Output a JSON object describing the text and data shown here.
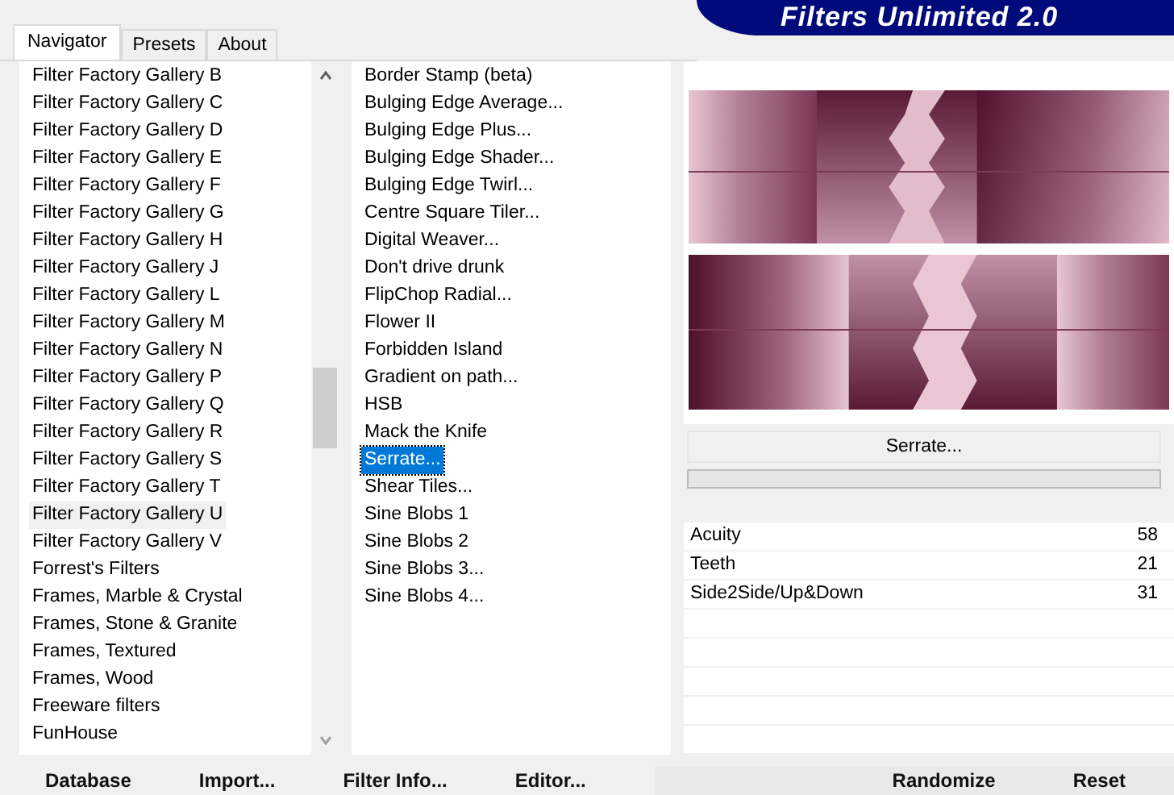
{
  "title": "Filters Unlimited 2.0",
  "tabs": [
    {
      "label": "Navigator",
      "selected": true
    },
    {
      "label": "Presets",
      "selected": false
    },
    {
      "label": "About",
      "selected": false
    }
  ],
  "categories": [
    {
      "label": "Filter Factory Gallery B",
      "selected": false
    },
    {
      "label": "Filter Factory Gallery C",
      "selected": false
    },
    {
      "label": "Filter Factory Gallery D",
      "selected": false
    },
    {
      "label": "Filter Factory Gallery E",
      "selected": false
    },
    {
      "label": "Filter Factory Gallery F",
      "selected": false
    },
    {
      "label": "Filter Factory Gallery G",
      "selected": false
    },
    {
      "label": "Filter Factory Gallery H",
      "selected": false
    },
    {
      "label": "Filter Factory Gallery J",
      "selected": false
    },
    {
      "label": "Filter Factory Gallery L",
      "selected": false
    },
    {
      "label": "Filter Factory Gallery M",
      "selected": false
    },
    {
      "label": "Filter Factory Gallery N",
      "selected": false
    },
    {
      "label": "Filter Factory Gallery P",
      "selected": false
    },
    {
      "label": "Filter Factory Gallery Q",
      "selected": false
    },
    {
      "label": "Filter Factory Gallery R",
      "selected": false
    },
    {
      "label": "Filter Factory Gallery S",
      "selected": false
    },
    {
      "label": "Filter Factory Gallery T",
      "selected": false
    },
    {
      "label": "Filter Factory Gallery U",
      "selected": true
    },
    {
      "label": "Filter Factory Gallery V",
      "selected": false
    },
    {
      "label": "Forrest's Filters",
      "selected": false
    },
    {
      "label": "Frames, Marble & Crystal",
      "selected": false
    },
    {
      "label": "Frames, Stone & Granite",
      "selected": false
    },
    {
      "label": "Frames, Textured",
      "selected": false
    },
    {
      "label": "Frames, Wood",
      "selected": false
    },
    {
      "label": "Freeware filters",
      "selected": false
    },
    {
      "label": "FunHouse",
      "selected": false
    }
  ],
  "filters": [
    {
      "label": "Border Stamp (beta)",
      "selected": false
    },
    {
      "label": "Bulging Edge Average...",
      "selected": false
    },
    {
      "label": "Bulging Edge Plus...",
      "selected": false
    },
    {
      "label": "Bulging Edge Shader...",
      "selected": false
    },
    {
      "label": "Bulging Edge Twirl...",
      "selected": false
    },
    {
      "label": "Centre Square Tiler...",
      "selected": false
    },
    {
      "label": "Digital Weaver...",
      "selected": false
    },
    {
      "label": "Don't drive drunk",
      "selected": false
    },
    {
      "label": "FlipChop Radial...",
      "selected": false
    },
    {
      "label": "Flower II",
      "selected": false
    },
    {
      "label": "Forbidden Island",
      "selected": false
    },
    {
      "label": "Gradient on path...",
      "selected": false
    },
    {
      "label": "HSB",
      "selected": false
    },
    {
      "label": "Mack the Knife",
      "selected": false
    },
    {
      "label": "Serrate...",
      "selected": true
    },
    {
      "label": "Shear Tiles...",
      "selected": false
    },
    {
      "label": "Sine Blobs 1",
      "selected": false
    },
    {
      "label": "Sine Blobs 2",
      "selected": false
    },
    {
      "label": "Sine Blobs 3...",
      "selected": false
    },
    {
      "label": "Sine Blobs 4...",
      "selected": false
    }
  ],
  "filter_name": "Serrate...",
  "progress": {
    "level": 0
  },
  "parameters": [
    {
      "name": "Acuity",
      "value": "58"
    },
    {
      "name": "Teeth",
      "value": "21"
    },
    {
      "name": "Side2Side/Up&Down",
      "value": "31"
    }
  ],
  "left_buttons": [
    "Database",
    "Import...",
    "Filter Info...",
    "Editor..."
  ],
  "right_buttons": [
    "Randomize",
    "Reset"
  ]
}
